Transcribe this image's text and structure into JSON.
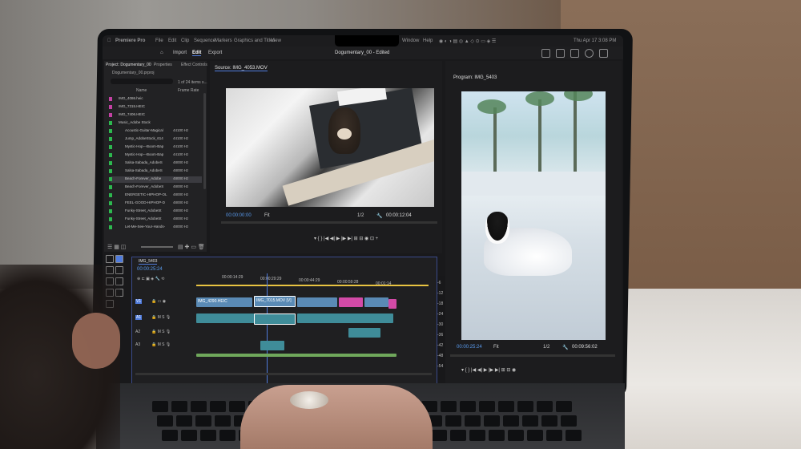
{
  "menubar": {
    "app": "Premiere Pro",
    "items": [
      "File",
      "Edit",
      "Clip",
      "Sequence",
      "Markers",
      "Graphics and Titles",
      "View",
      "Window",
      "Help"
    ],
    "datetime": "Thu Apr 17  3:08 PM"
  },
  "header": {
    "tabs": [
      "Import",
      "Edit",
      "Export"
    ],
    "title": "Dogumentary_00 - Edited"
  },
  "project": {
    "tabs": [
      "Project: Dogumentary_00",
      "Properties",
      "Effect Controls"
    ],
    "file": "Dogumentary_00.prproj",
    "count": "1 of 24 items s...",
    "col_name": "Name",
    "col_rate": "Frame Rate",
    "items": [
      {
        "name": "IMG_4086.heic",
        "rate": ""
      },
      {
        "name": "IMG_7315.HEIC",
        "rate": ""
      },
      {
        "name": "IMG_7406.HEIC",
        "rate": ""
      },
      {
        "name": "Music_Adobe Stock",
        "rate": ""
      },
      {
        "name": "Acoustic-Guitar-Magical",
        "rate": "44100 Hz"
      },
      {
        "name": "Jump_AdobeStock_614",
        "rate": "44100 Hz"
      },
      {
        "name": "Mystic-Hop---Boom-Bap",
        "rate": "44100 Hz"
      },
      {
        "name": "Mystic-Hop---Boom-Bap",
        "rate": "44100 Hz"
      },
      {
        "name": "Salsa-Sabada_AdobeS",
        "rate": "48000 Hz"
      },
      {
        "name": "Salsa-Sabada_AdobeS",
        "rate": "48000 Hz"
      },
      {
        "name": "Beach-Forever_Adobe",
        "rate": "48000 Hz"
      },
      {
        "name": "Beach-Forever_AdobeS",
        "rate": "48000 Hz"
      },
      {
        "name": "ENERGETIC-HIPHOP-OL",
        "rate": "48000 Hz"
      },
      {
        "name": "FEEL-GOOD-HIPHOP-D",
        "rate": "48000 Hz"
      },
      {
        "name": "Funky-Street_AdobeSt",
        "rate": "48000 Hz"
      },
      {
        "name": "Funky-Street_AdobeSt",
        "rate": "48000 Hz"
      },
      {
        "name": "Let-Me-See-Your-Hands-",
        "rate": "48000 Hz"
      }
    ]
  },
  "source": {
    "label": "Source: IMG_4053.MOV",
    "timecode": "00:00:00:00",
    "fit": "Fit",
    "ratio": "1/2",
    "duration": "00:00:12:04"
  },
  "program": {
    "label": "Program: IMG_5403",
    "timecode": "00:00:25:24",
    "fit": "Fit",
    "ratio": "1/2",
    "duration": "00:09:56:02"
  },
  "timeline": {
    "tab": "IMG_5403",
    "timecode": "00:00:25:24",
    "ruler": [
      "00:00:14:29",
      "00:00:29:29",
      "00:00:44:29",
      "00:00:59:28",
      "00:01:14"
    ],
    "tracks": [
      "V1",
      "A1",
      "A2",
      "A3"
    ],
    "clips": [
      "IMG_4290.HEIC",
      "IMG_7015.MOV [V]"
    ],
    "meter": [
      "-6",
      "-12",
      "-18",
      "-24",
      "-30",
      "-36",
      "-42",
      "-48",
      "-54"
    ]
  },
  "colors": {
    "accent_blue": "#4f7bdc",
    "timecode_blue": "#5a9cf0",
    "clip_video": "#5a8ab5",
    "clip_audio": "#3f8c99",
    "clip_pink": "#d34aa7",
    "playhead": "#e8c341"
  }
}
